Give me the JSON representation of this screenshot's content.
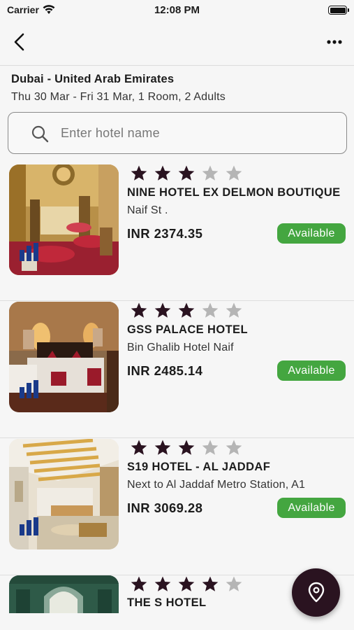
{
  "status_bar": {
    "carrier": "Carrier",
    "time": "12:08 PM"
  },
  "search_summary": {
    "destination": "Dubai - United Arab Emirates",
    "details": "Thu 30 Mar - Fri 31 Mar, 1 Room, 2 Adults"
  },
  "search": {
    "placeholder": "Enter hotel name",
    "value": ""
  },
  "colors": {
    "star_filled": "#2a1320",
    "star_empty": "#b5b5b5",
    "available": "#44a640",
    "fab": "#2a1320"
  },
  "hotels": [
    {
      "stars": 3,
      "max_stars": 5,
      "name": "NINE HOTEL EX DELMON BOUTIQUE",
      "address": "Naif St .",
      "price": "INR 2374.35",
      "status": "Available"
    },
    {
      "stars": 3,
      "max_stars": 5,
      "name": "GSS PALACE HOTEL",
      "address": "Bin Ghalib Hotel Naif",
      "price": "INR 2485.14",
      "status": "Available"
    },
    {
      "stars": 3,
      "max_stars": 5,
      "name": "S19 HOTEL - AL JADDAF",
      "address": "Next to Al Jaddaf Metro Station, A1",
      "price": "INR 3069.28",
      "status": "Available"
    },
    {
      "stars": 4,
      "max_stars": 5,
      "name": "THE S HOTEL",
      "address": "",
      "price": "",
      "status": ""
    }
  ],
  "icons": {
    "back": "chevron-left-icon",
    "more": "ellipsis-icon",
    "search": "search-icon",
    "map": "map-pin-icon"
  }
}
